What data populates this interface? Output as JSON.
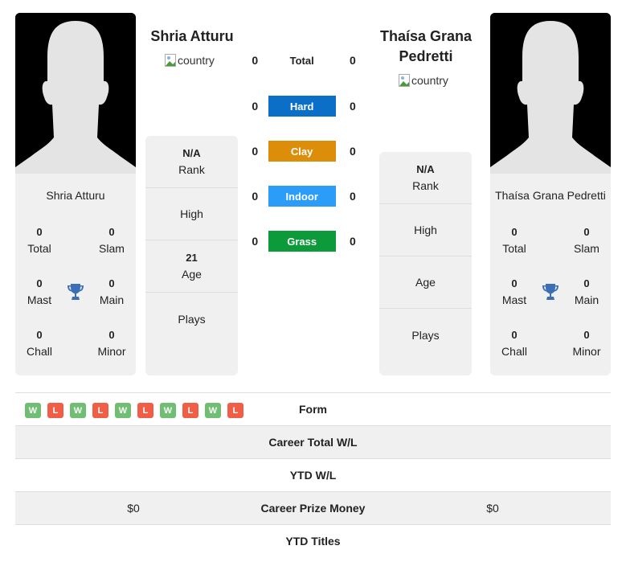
{
  "player_left": {
    "name": "Shria Atturu",
    "country_alt": "country",
    "card_name": "Shria Atturu",
    "titles": {
      "total": {
        "value": "0",
        "label": "Total"
      },
      "slam": {
        "value": "0",
        "label": "Slam"
      },
      "mast": {
        "value": "0",
        "label": "Mast"
      },
      "main": {
        "value": "0",
        "label": "Main"
      },
      "chall": {
        "value": "0",
        "label": "Chall"
      },
      "minor": {
        "value": "0",
        "label": "Minor"
      }
    },
    "info": {
      "rank_value": "N/A",
      "rank_label": "Rank",
      "high_value": "",
      "high_label": "High",
      "age_value": "21",
      "age_label": "Age",
      "plays_value": "",
      "plays_label": "Plays"
    }
  },
  "player_right": {
    "name": "Thaísa Grana Pedretti",
    "country_alt": "country",
    "card_name": "Thaísa Grana Pedretti",
    "titles": {
      "total": {
        "value": "0",
        "label": "Total"
      },
      "slam": {
        "value": "0",
        "label": "Slam"
      },
      "mast": {
        "value": "0",
        "label": "Mast"
      },
      "main": {
        "value": "0",
        "label": "Main"
      },
      "chall": {
        "value": "0",
        "label": "Chall"
      },
      "minor": {
        "value": "0",
        "label": "Minor"
      }
    },
    "info": {
      "rank_value": "N/A",
      "rank_label": "Rank",
      "high_value": "",
      "high_label": "High",
      "age_value": "",
      "age_label": "Age",
      "plays_value": "",
      "plays_label": "Plays"
    }
  },
  "surfaces": [
    {
      "label": "Total",
      "left": "0",
      "right": "0",
      "color": ""
    },
    {
      "label": "Hard",
      "left": "0",
      "right": "0",
      "color": "#0c6fc7"
    },
    {
      "label": "Clay",
      "left": "0",
      "right": "0",
      "color": "#dc8d0a"
    },
    {
      "label": "Indoor",
      "left": "0",
      "right": "0",
      "color": "#2b9cf7"
    },
    {
      "label": "Grass",
      "left": "0",
      "right": "0",
      "color": "#0c9a3a"
    }
  ],
  "form": {
    "label": "Form",
    "results": [
      "W",
      "L",
      "W",
      "L",
      "W",
      "L",
      "W",
      "L",
      "W",
      "L"
    ],
    "win_color": "#6fbe72",
    "loss_color": "#ef5e45"
  },
  "rows": [
    {
      "label": "Career Total W/L",
      "left": "",
      "right": ""
    },
    {
      "label": "YTD W/L",
      "left": "",
      "right": ""
    },
    {
      "label": "Career Prize Money",
      "left": "$0",
      "right": "$0"
    },
    {
      "label": "YTD Titles",
      "left": "",
      "right": ""
    }
  ],
  "icons": {
    "trophy": "trophy-icon",
    "avatar": "avatar-silhouette",
    "country": "broken-image-icon"
  },
  "colors": {
    "trophy": "#3a6fb7",
    "card_bg": "#f0f0f0"
  }
}
